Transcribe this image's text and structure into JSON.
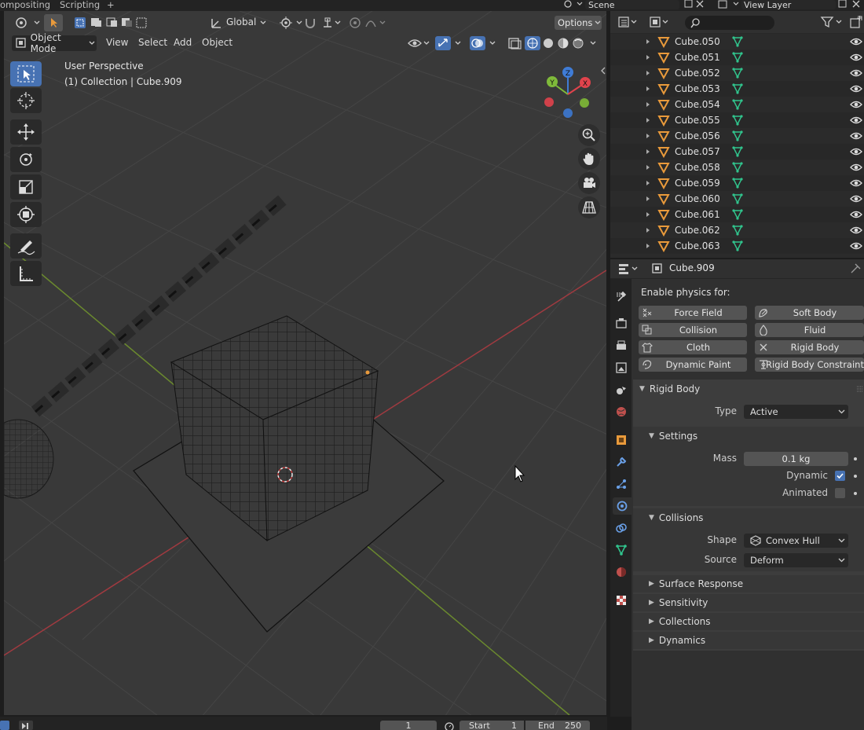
{
  "workspace_tabs": [
    "ompositing",
    "Scripting",
    "+"
  ],
  "scene": {
    "name": "Scene",
    "view_layer": "View Layer"
  },
  "viewport": {
    "orientation": "Global",
    "options_label": "Options",
    "mode": "Object Mode",
    "menus": [
      "View",
      "Select",
      "Add",
      "Object"
    ],
    "overlay_title": "User Perspective",
    "overlay_subtitle": "(1) Collection | Cube.909",
    "gizmo_axes": [
      "Y",
      "Z",
      "X"
    ]
  },
  "outliner": {
    "items": [
      "Cube.050",
      "Cube.051",
      "Cube.052",
      "Cube.053",
      "Cube.054",
      "Cube.055",
      "Cube.056",
      "Cube.057",
      "Cube.058",
      "Cube.059",
      "Cube.060",
      "Cube.061",
      "Cube.062",
      "Cube.063"
    ]
  },
  "properties": {
    "object_name": "Cube.909",
    "enable_physics_label": "Enable physics for:",
    "physics_buttons": [
      {
        "label": "Force Field",
        "icon": "force-field-icon"
      },
      {
        "label": "Soft Body",
        "icon": "soft-body-icon"
      },
      {
        "label": "Collision",
        "icon": "collision-icon"
      },
      {
        "label": "Fluid",
        "icon": "fluid-icon"
      },
      {
        "label": "Cloth",
        "icon": "cloth-icon"
      },
      {
        "label": "Rigid Body",
        "icon": "close-icon"
      },
      {
        "label": "Dynamic Paint",
        "icon": "dynamic-paint-icon"
      },
      {
        "label": "Rigid Body Constraint",
        "icon": "constraint-icon"
      }
    ],
    "rigid_body": {
      "title": "Rigid Body",
      "type_label": "Type",
      "type_value": "Active",
      "settings_title": "Settings",
      "mass_label": "Mass",
      "mass_value": "0.1 kg",
      "dynamic_label": "Dynamic",
      "dynamic_checked": true,
      "animated_label": "Animated",
      "animated_checked": false,
      "collisions_title": "Collisions",
      "shape_label": "Shape",
      "shape_value": "Convex Hull",
      "source_label": "Source",
      "source_value": "Deform",
      "collapsed_panels": [
        "Surface Response",
        "Sensitivity",
        "Collections",
        "Dynamics"
      ]
    }
  },
  "timeline": {
    "current_frame": "1",
    "start_label": "Start",
    "start_value": "1",
    "end_label": "End",
    "end_value": "250"
  },
  "colors": {
    "accent": "#4772b3",
    "object_orange": "#e99a3b",
    "mesh_green": "#31c48d",
    "axis_x": "#e0434c",
    "axis_y": "#7fba3a",
    "axis_z": "#3f7cd6"
  }
}
